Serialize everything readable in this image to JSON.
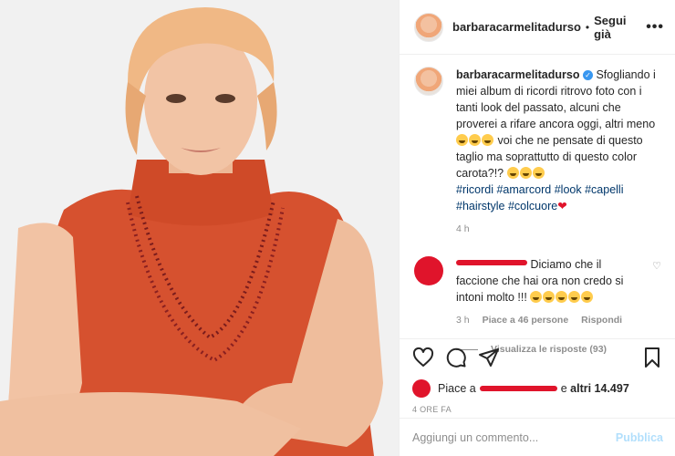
{
  "header": {
    "username": "barbaracarmelitadurso",
    "separator": "•",
    "follow_label": "Segui già",
    "more_label": "•••"
  },
  "caption": {
    "username": "barbaracarmelitadurso",
    "text1": "Sfogliando i miei album di ricordi ritrovo foto con i tanti look del passato, alcuni che proverei a rifare ancora oggi, altri meno",
    "text2": "voi che ne pensate di questo taglio ma soprattutto di questo color carota?!?",
    "hashtags": [
      "#ricordi",
      "#amarcord",
      "#look",
      "#capelli",
      "#hairstyle",
      "#colcuore"
    ],
    "time": "4 h"
  },
  "comment": {
    "text": "Diciamo che il faccione che hai ora non credo si intoni molto !!!",
    "time": "3 h",
    "likes": "Piace a 46 persone",
    "reply": "Rispondi",
    "view_replies": "Visualizza le risposte (93)"
  },
  "post": {
    "likes_prefix": "Piace a",
    "likes_suffix": "e",
    "likes_count": "altri 14.497",
    "ago": "4 ORE FA"
  },
  "add_comment": {
    "placeholder": "Aggiungi un commento...",
    "publish_label": "Pubblica"
  },
  "colors": {
    "accent": "#3897f0",
    "redaction": "#e0142b",
    "shirt": "#d6512f",
    "hair": "#f0b885"
  }
}
